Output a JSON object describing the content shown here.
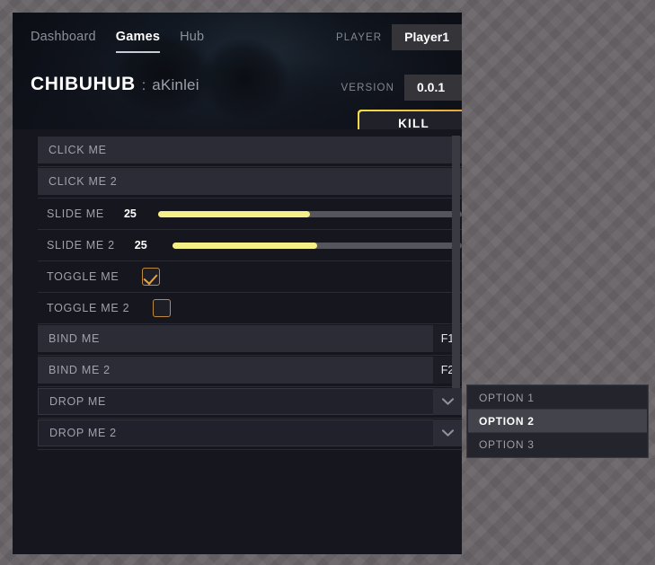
{
  "header": {
    "tabs": [
      {
        "label": "Dashboard",
        "active": false
      },
      {
        "label": "Games",
        "active": true
      },
      {
        "label": "Hub",
        "active": false
      }
    ],
    "player_label": "PLAYER",
    "player_value": "Player1",
    "version_label": "VERSION",
    "version_value": "0.0.1",
    "brand": "CHIBUHUB",
    "brand_separator": ":",
    "brand_sub": "aKinlei",
    "kill_label": "KILL"
  },
  "rows": {
    "click_me": "CLICK ME",
    "click_me_2": "CLICK ME 2",
    "slide_me": "SLIDE ME",
    "slide_me_value": "25",
    "slide_me_2": "SLIDE ME 2",
    "slide_me_2_value": "25",
    "toggle_me": "TOGGLE ME",
    "toggle_me_2": "TOGGLE ME 2",
    "bind_me": "BIND ME",
    "bind_me_key": "F1",
    "bind_me_2": "BIND ME 2",
    "bind_me_2_key": "F2",
    "drop_me": "DROP ME",
    "drop_me_2": "DROP ME 2"
  },
  "options": [
    {
      "label": "OPTION 1",
      "selected": false
    },
    {
      "label": "OPTION 2",
      "selected": true
    },
    {
      "label": "OPTION 3",
      "selected": false
    }
  ],
  "colors": {
    "accent_yellow": "#f5ef87",
    "accent_orange": "#e8a33e",
    "panel_bg": "#16161f",
    "row_bg": "#2c2c36",
    "text_muted": "#9ea1aa"
  }
}
